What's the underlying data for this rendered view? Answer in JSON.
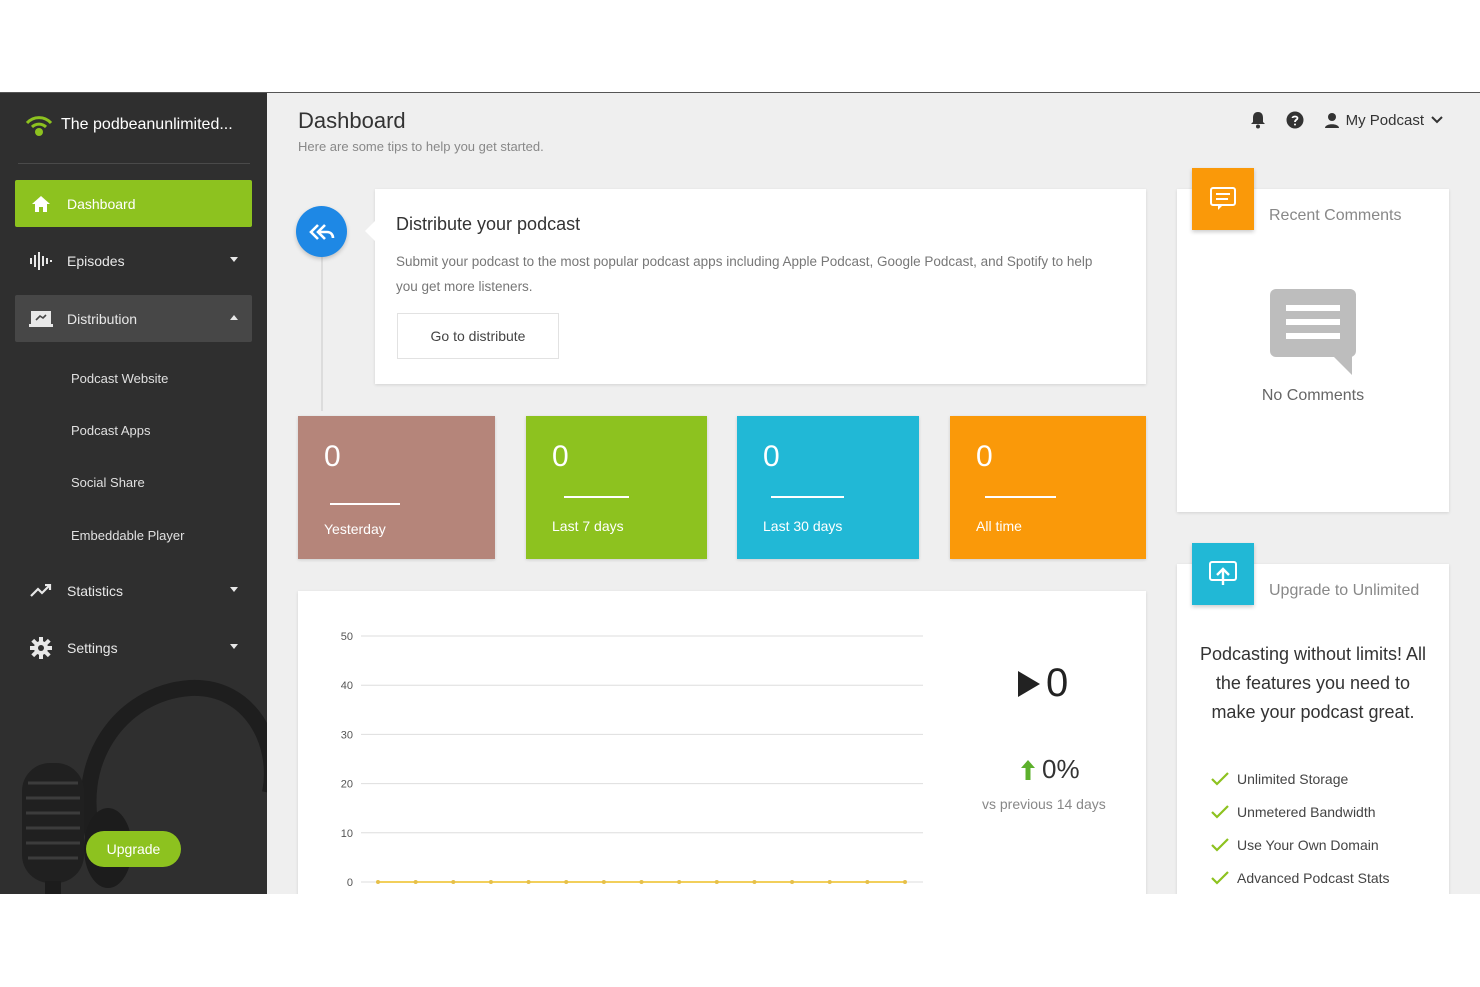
{
  "brand": {
    "name": "The podbeanunlimited..."
  },
  "sidebar": {
    "items": [
      {
        "label": "Dashboard",
        "icon": "home-icon"
      },
      {
        "label": "Episodes",
        "icon": "waveform-icon"
      },
      {
        "label": "Distribution",
        "icon": "laptop-icon"
      },
      {
        "label": "Statistics",
        "icon": "trend-icon"
      },
      {
        "label": "Settings",
        "icon": "gear-icon"
      }
    ],
    "distribution_sub": [
      "Podcast Website",
      "Podcast Apps",
      "Social Share",
      "Embeddable Player"
    ],
    "upgrade_label": "Upgrade"
  },
  "header": {
    "title": "Dashboard",
    "subtitle": "Here are some tips to help you get started.",
    "account_label": "My Podcast"
  },
  "distribute": {
    "title": "Distribute your podcast",
    "text": "Submit your podcast to the most popular podcast apps including Apple Podcast, Google Podcast, and Spotify to help you get more listeners.",
    "button": "Go to distribute"
  },
  "stats": [
    {
      "value": "0",
      "label": "Yesterday",
      "color": "#b5857a"
    },
    {
      "value": "0",
      "label": "Last 7 days",
      "color": "#8dc21f"
    },
    {
      "value": "0",
      "label": "Last 30 days",
      "color": "#21b8d6"
    },
    {
      "value": "0",
      "label": "All time",
      "color": "#fa9909"
    }
  ],
  "plays": {
    "total": "0",
    "change": "0%",
    "compare": "vs previous 14 days"
  },
  "comments": {
    "title": "Recent Comments",
    "empty": "No Comments"
  },
  "upgrade": {
    "title": "Upgrade to Unlimited",
    "pitch": "Podcasting without limits! All the features you need to make your podcast great.",
    "features": [
      "Unlimited Storage",
      "Unmetered Bandwidth",
      "Use Your Own Domain",
      "Advanced Podcast Stats"
    ]
  },
  "colors": {
    "accent_green": "#8dc21f",
    "accent_orange": "#fa9909",
    "accent_teal": "#21b8d6",
    "accent_blue": "#1e88e5"
  },
  "chart_data": {
    "type": "line",
    "yticks": [
      "50",
      "40",
      "30",
      "20",
      "10",
      "0"
    ],
    "ylim": [
      0,
      50
    ],
    "series": [
      {
        "values": [
          0,
          0,
          0,
          0,
          0,
          0,
          0,
          0,
          0,
          0,
          0,
          0,
          0,
          0,
          0
        ]
      }
    ],
    "grid": true
  }
}
